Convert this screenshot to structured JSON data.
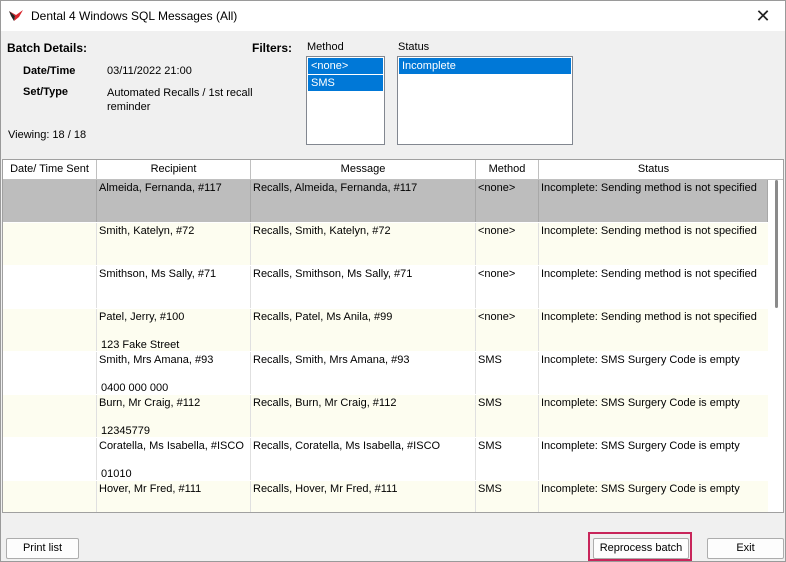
{
  "window": {
    "title": "Dental 4 Windows SQL Messages (All)"
  },
  "batch": {
    "heading": "Batch Details:",
    "date_label": "Date/Time",
    "date_value": "03/11/2022 21:00",
    "set_label": "Set/Type",
    "set_value": "Automated Recalls / 1st recall reminder",
    "viewing": "Viewing:  18 / 18"
  },
  "filters": {
    "heading": "Filters:",
    "method_label": "Method",
    "method_options": [
      "<none>",
      "SMS"
    ],
    "status_label": "Status",
    "status_options": [
      "Incomplete"
    ]
  },
  "grid": {
    "columns": [
      "Date/ Time Sent",
      "Recipient",
      "Message",
      "Method",
      "Status"
    ],
    "rows": [
      {
        "sent": "",
        "recipient": "Almeida, Fernanda, #117",
        "recipient_sub": "",
        "message": "Recalls,  Almeida, Fernanda, #117",
        "method": "<none>",
        "status": "Incomplete: Sending method is not specified"
      },
      {
        "sent": "",
        "recipient": "Smith, Katelyn, #72",
        "recipient_sub": "",
        "message": "Recalls,  Smith, Katelyn, #72",
        "method": "<none>",
        "status": "Incomplete: Sending method is not specified"
      },
      {
        "sent": "",
        "recipient": "Smithson, Ms Sally, #71",
        "recipient_sub": "",
        "message": "Recalls,  Smithson, Ms Sally, #71",
        "method": "<none>",
        "status": "Incomplete: Sending method is not specified"
      },
      {
        "sent": "",
        "recipient": "Patel, Jerry, #100",
        "recipient_sub": "123 Fake Street",
        "message": "Recalls,  Patel, Ms Anila, #99",
        "method": "<none>",
        "status": "Incomplete: Sending method is not specified"
      },
      {
        "sent": "",
        "recipient": "Smith, Mrs Amana, #93",
        "recipient_sub": "0400 000 000",
        "message": "Recalls,  Smith, Mrs Amana, #93",
        "method": "SMS",
        "status": "Incomplete: SMS Surgery Code is empty"
      },
      {
        "sent": "",
        "recipient": "Burn, Mr Craig, #112",
        "recipient_sub": "12345779",
        "message": "Recalls,  Burn, Mr Craig, #112",
        "method": "SMS",
        "status": "Incomplete: SMS Surgery Code is empty"
      },
      {
        "sent": "",
        "recipient": "Coratella, Ms Isabella, #ISCO",
        "recipient_sub": "01010",
        "message": "Recalls,  Coratella, Ms Isabella, #ISCO",
        "method": "SMS",
        "status": "Incomplete: SMS Surgery Code is empty"
      },
      {
        "sent": "",
        "recipient": "Hover, Mr Fred, #111",
        "recipient_sub": "",
        "message": "Recalls,  Hover, Mr Fred, #111",
        "method": "SMS",
        "status": "Incomplete: SMS Surgery Code is empty"
      }
    ]
  },
  "footer": {
    "print_label": "Print list",
    "reprocess_label": "Reprocess batch",
    "exit_label": "Exit"
  },
  "colors": {
    "selection": "#0078d7",
    "highlight": "#c8255a",
    "row_selected": "#bdbdbd"
  }
}
